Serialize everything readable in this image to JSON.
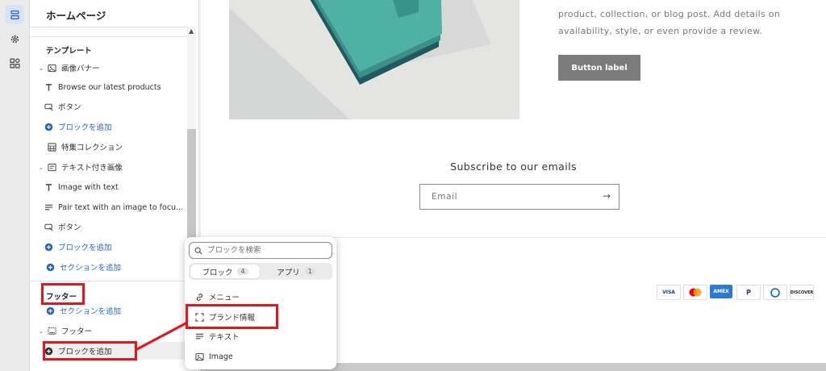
{
  "sidebar": {
    "title": "ホームページ",
    "template_label": "テンプレート",
    "items": {
      "image_banner": "画像バナー",
      "browse": "Browse our latest products",
      "button1": "ボタン",
      "add_block1": "ブロックを追加",
      "featured": "特集コレクション",
      "image_text": "テキスト付き画像",
      "image_with_text": "Image with text",
      "pair_text": "Pair text with an image to focu...",
      "button2": "ボタン",
      "add_block2": "ブロックを追加",
      "add_section1": "セクションを追加",
      "footer_label": "フッター",
      "add_section2": "セクションを追加",
      "footer": "フッター",
      "add_block3": "ブロックを追加"
    }
  },
  "preview": {
    "text_line1": "product, collection, or blog post. Add details on",
    "text_line2": "availability, style, or even provide a review.",
    "button_label": "Button label",
    "subscribe_title": "Subscribe to our emails",
    "email_placeholder": "Email",
    "payments": [
      "VISA",
      "",
      "AMEX",
      "P",
      "",
      "DISCOVER"
    ]
  },
  "popup": {
    "search_placeholder": "ブロックを検索",
    "tabs": [
      {
        "label": "ブロック",
        "count": "4"
      },
      {
        "label": "アプリ",
        "count": "1"
      }
    ],
    "items": [
      "メニュー",
      "ブランド情報",
      "テキスト",
      "Image"
    ]
  },
  "colors": {
    "accent_blue": "#2463d2",
    "annotation_red": "#e8141b",
    "button_gray": "#7b7b7b",
    "teal_dark": "#1f5a60",
    "teal_light": "#4fb0a4"
  }
}
